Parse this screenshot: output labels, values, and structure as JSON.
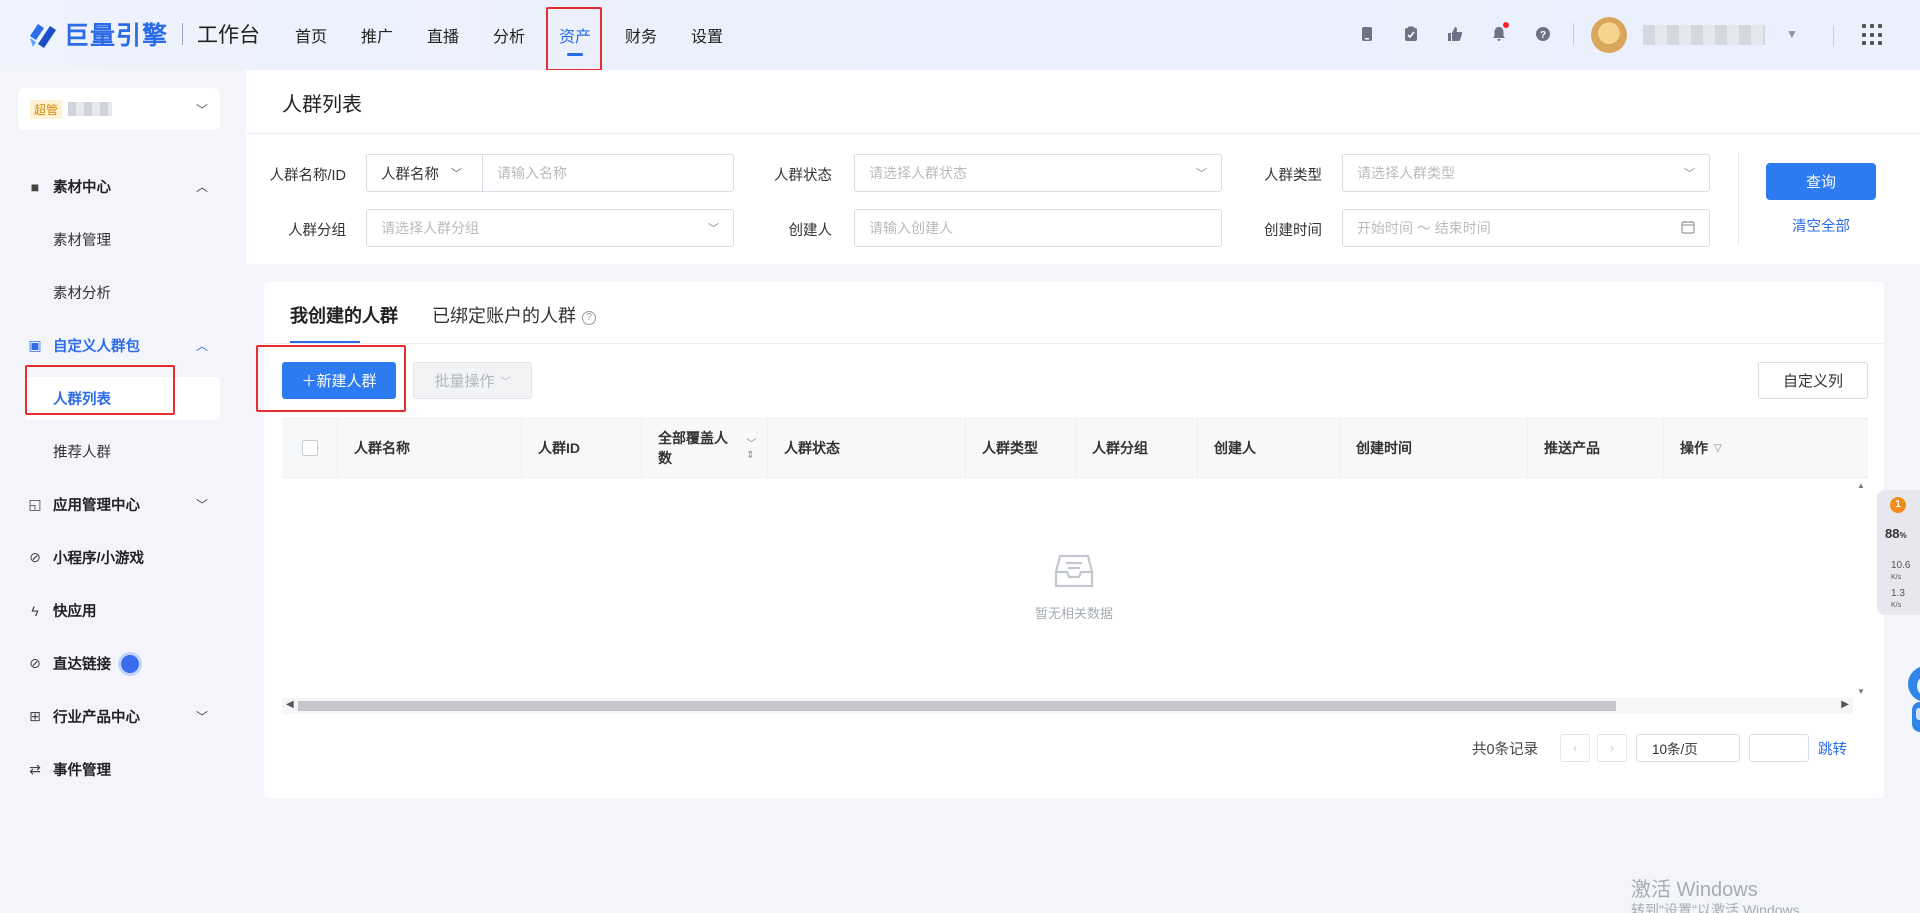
{
  "topbar": {
    "brand": "巨量引擎",
    "subtitle": "工作台",
    "nav": [
      "首页",
      "推广",
      "直播",
      "分析",
      "资产",
      "财务",
      "设置"
    ],
    "active_nav": "资产",
    "icons": [
      "mobile-icon",
      "clipboard-icon",
      "thumb-icon",
      "bell-icon",
      "help-icon"
    ]
  },
  "account": {
    "badge": "超管"
  },
  "sidebar": {
    "groups": [
      {
        "label": "素材中心",
        "icon": "video-icon",
        "expanded": true,
        "children": [
          "素材管理",
          "素材分析"
        ]
      },
      {
        "label": "自定义人群包",
        "icon": "audience-icon",
        "expanded": true,
        "active": true,
        "children": [
          "人群列表",
          "推荐人群"
        ],
        "active_child": "人群列表"
      },
      {
        "label": "应用管理中心",
        "icon": "app-icon",
        "expanded": false
      },
      {
        "label": "小程序/小游戏",
        "icon": "miniprogram-icon"
      },
      {
        "label": "快应用",
        "icon": "lightning-icon"
      },
      {
        "label": "直达链接",
        "icon": "link-icon"
      },
      {
        "label": "行业产品中心",
        "icon": "grid-icon",
        "expanded": false
      },
      {
        "label": "事件管理",
        "icon": "event-icon"
      }
    ]
  },
  "page": {
    "title": "人群列表"
  },
  "filters": {
    "name_label": "人群名称/ID",
    "name_type": "人群名称",
    "name_placeholder": "请输入名称",
    "status_label": "人群状态",
    "status_placeholder": "请选择人群状态",
    "type_label": "人群类型",
    "type_placeholder": "请选择人群类型",
    "group_label": "人群分组",
    "group_placeholder": "请选择人群分组",
    "creator_label": "创建人",
    "creator_placeholder": "请输入创建人",
    "time_label": "创建时间",
    "time_placeholder": "开始时间 ～ 结束时间",
    "query_button": "查询",
    "clear_button": "清空全部"
  },
  "tabs": [
    "我创建的人群",
    "已绑定账户的人群"
  ],
  "toolbar": {
    "new_button": "＋新建人群",
    "batch_button": "批量操作",
    "columns_button": "自定义列"
  },
  "table": {
    "columns": [
      "人群名称",
      "人群ID",
      "全部覆盖人数",
      "人群状态",
      "人群类型",
      "人群分组",
      "创建人",
      "创建时间",
      "推送产品",
      "操作"
    ],
    "rows": [],
    "empty_text": "暂无相关数据"
  },
  "pagination": {
    "total_text": "共0条记录",
    "page_size": "10条/页",
    "jump_label": "跳转"
  },
  "widget": {
    "badge": "1",
    "cpu": "88",
    "cpu_unit": "%",
    "up": "10.6",
    "down": "1.3",
    "unit": "K/s"
  },
  "watermark": {
    "line1": "激活 Windows",
    "line2": "转到\"设置\"以激活 Windows"
  }
}
